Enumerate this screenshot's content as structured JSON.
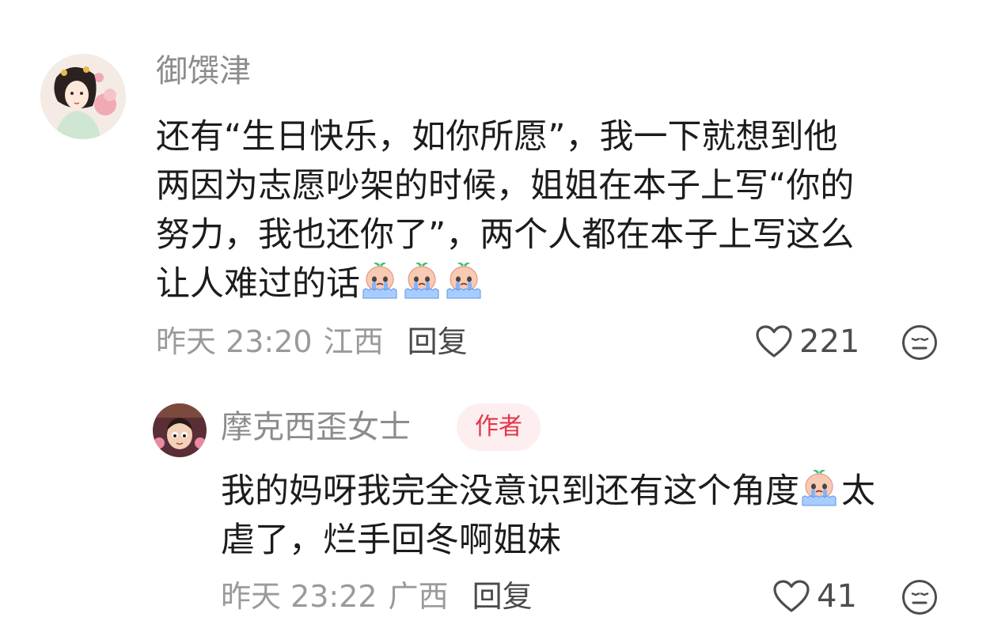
{
  "comments": [
    {
      "username": "御馔津",
      "lines": [
        "还有“生日快乐，如你所愿”，我一下就想到他",
        "两因为志愿吵架的时候，姐姐在本子上写“你的",
        "努力，我也还你了”，两个人都在本子上写这么",
        "让人难过的话"
      ],
      "emoji": "crying-emoji",
      "emoji_count": 3,
      "time": "昨天 23:20",
      "region": "江西",
      "reply_label": "回复",
      "likes": "221",
      "like_icon": "heart-outline-icon",
      "dislike_icon": "neutral-face-icon"
    },
    {
      "username": "摩克西歪女士",
      "badge": "作者",
      "line1_before": "我的妈呀我完全没意识到还有这个角度",
      "line1_after": "太",
      "line2": "虐了，烂手回冬啊姐妹",
      "emoji": "crying-emoji",
      "time": "昨天 23:22",
      "region": "广西",
      "reply_label": "回复",
      "likes": "41",
      "like_icon": "heart-outline-icon",
      "dislike_icon": "neutral-face-icon"
    }
  ],
  "colors": {
    "username": "#8c8c8c",
    "badge_text": "#e2364a",
    "badge_bg": "#fdeef0",
    "meta": "#9a9a9a"
  }
}
